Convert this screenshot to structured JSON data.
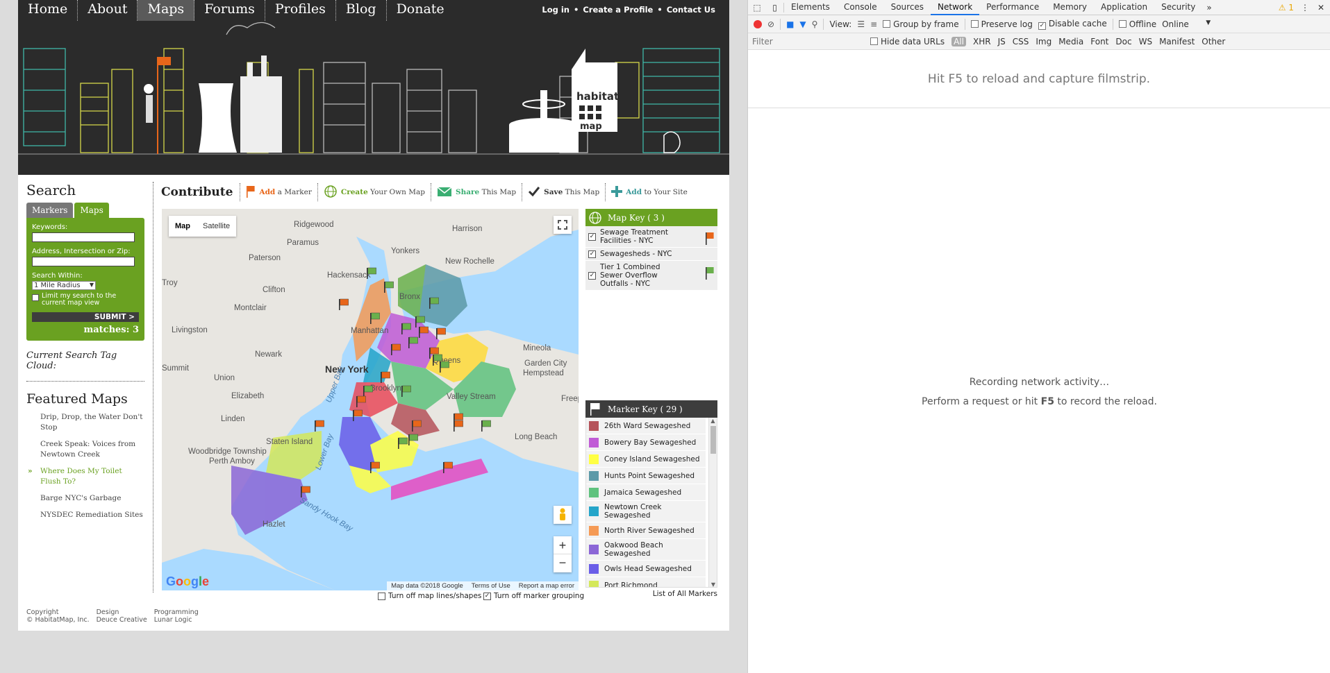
{
  "nav": {
    "items": [
      "Home",
      "About",
      "Maps",
      "Forums",
      "Profiles",
      "Blog",
      "Donate"
    ],
    "active_index": 2,
    "top_links": [
      "Log in",
      "Create a Profile",
      "Contact Us"
    ],
    "separator": "•"
  },
  "banner": {
    "logo_top": "habitat",
    "logo_bottom": "map"
  },
  "sidebar": {
    "search_title": "Search",
    "tabs": [
      "Markers",
      "Maps"
    ],
    "active_tab": 1,
    "keywords_label": "Keywords:",
    "keywords_value": "",
    "address_label": "Address, Intersection or Zip:",
    "address_value": "",
    "search_within_label": "Search Within:",
    "radius_value": "1 Mile Radius",
    "limit_label": "Limit my search to the current map view",
    "submit_label": "SUBMIT >",
    "matches_text": "matches: 3",
    "tag_cloud_label": "Current Search Tag Cloud:",
    "featured_title": "Featured Maps",
    "featured": [
      "Drip, Drop, the Water Don't Stop",
      "Creek Speak: Voices from Newtown Creek",
      "Where Does My Toilet Flush To?",
      "Barge NYC's Garbage",
      "NYSDEC Remediation Sites"
    ],
    "featured_active_index": 2
  },
  "contribute": {
    "title": "Contribute",
    "actions": [
      {
        "strong": "Add",
        "rest": "a Marker",
        "color": "#e8661a",
        "icon": "flag-icon"
      },
      {
        "strong": "Create",
        "rest": "Your Own Map",
        "color": "#6aa121",
        "icon": "globe-icon"
      },
      {
        "strong": "Share",
        "rest": "This Map",
        "color": "#3aae72",
        "icon": "envelope-icon"
      },
      {
        "strong": "Save",
        "rest": "This Map",
        "color": "#333333",
        "icon": "checkmark-icon"
      },
      {
        "strong": "Add",
        "rest": "to Your Site",
        "color": "#3a9a9a",
        "icon": "plus-icon"
      }
    ]
  },
  "map": {
    "type_buttons": [
      "Map",
      "Satellite"
    ],
    "active_type": 0,
    "place_labels": [
      "Ridgewood",
      "Paramus",
      "Harrison",
      "Yonkers",
      "New Rochelle",
      "Paterson",
      "Hackensack",
      "Troy",
      "Clifton",
      "Bronx",
      "Montclair",
      "Manhattan",
      "Livingston",
      "Newark",
      "New York",
      "Mineola",
      "Queens",
      "Garden City",
      "Summit",
      "Union",
      "Hempstead",
      "Brooklyn",
      "Elizabeth",
      "Valley Stream",
      "Freepo",
      "Linden",
      "Staten Island",
      "Long Beach",
      "Woodbridge Township",
      "Perth Amboy",
      "Hazlet",
      "Upper Bay",
      "Lower Bay",
      "Sandy Hook Bay"
    ],
    "footer_items": [
      "Map data ©2018 Google",
      "Terms of Use",
      "Report a map error"
    ],
    "logo": "Google",
    "zoom_in": "+",
    "zoom_out": "−",
    "option_lines": "Turn off map lines/shapes",
    "option_lines_checked": false,
    "option_grouping": "Turn off marker grouping",
    "option_grouping_checked": true
  },
  "map_key": {
    "title": "Map Key ( 3 )",
    "items": [
      {
        "label": "Sewage Treatment Facilities - NYC",
        "checked": true,
        "flag_color": "#e8661a"
      },
      {
        "label": "Sewagesheds - NYC",
        "checked": true,
        "flag_color": ""
      },
      {
        "label": "Tier 1 Combined Sewer Overflow Outfalls - NYC",
        "checked": true,
        "flag_color": "#6ab04c"
      }
    ]
  },
  "marker_key": {
    "title": "Marker Key ( 29 )",
    "items": [
      {
        "label": "26th Ward Sewageshed",
        "color": "#b5535a"
      },
      {
        "label": "Bowery Bay Sewageshed",
        "color": "#c05bd6"
      },
      {
        "label": "Coney Island Sewageshed",
        "color": "#ffff44"
      },
      {
        "label": "Hunts Point Sewageshed",
        "color": "#5c9aa8"
      },
      {
        "label": "Jamaica Sewageshed",
        "color": "#5fc27e"
      },
      {
        "label": "Newtown Creek Sewageshed",
        "color": "#25a5c9"
      },
      {
        "label": "North River Sewageshed",
        "color": "#f59a55"
      },
      {
        "label": "Oakwood Beach Sewageshed",
        "color": "#8b66d6"
      },
      {
        "label": "Owls Head Sewageshed",
        "color": "#6a5de8"
      },
      {
        "label": "Port Richmond",
        "color": "#d4e85a"
      }
    ],
    "list_all": "List of All Markers"
  },
  "footer": [
    {
      "title": "Copyright",
      "value": "© HabitatMap, Inc."
    },
    {
      "title": "Design",
      "value": "Deuce Creative"
    },
    {
      "title": "Programming",
      "value": "Lunar Logic"
    }
  ],
  "devtools": {
    "tabs": [
      "Elements",
      "Console",
      "Sources",
      "Network",
      "Performance",
      "Memory",
      "Application",
      "Security"
    ],
    "active_tab": 3,
    "warning_count": "1",
    "view_label": "View:",
    "group_by_frame": "Group by frame",
    "preserve_log": "Preserve log",
    "disable_cache": "Disable cache",
    "offline": "Offline",
    "throttle": "Online",
    "filter_placeholder": "Filter",
    "hide_data_urls": "Hide data URLs",
    "filter_types": [
      "All",
      "XHR",
      "JS",
      "CSS",
      "Img",
      "Media",
      "Font",
      "Doc",
      "WS",
      "Manifest",
      "Other"
    ],
    "filmstrip_hint": "Hit F5 to reload and capture filmstrip.",
    "recording": "Recording network activity…",
    "perform_prefix": "Perform a request or hit",
    "perform_key": "F5",
    "perform_suffix": "to record the reload."
  },
  "colors": {
    "green": "#6aa121",
    "orange": "#e8661a",
    "dark": "#2b2b2b",
    "water": "#aadaff"
  }
}
